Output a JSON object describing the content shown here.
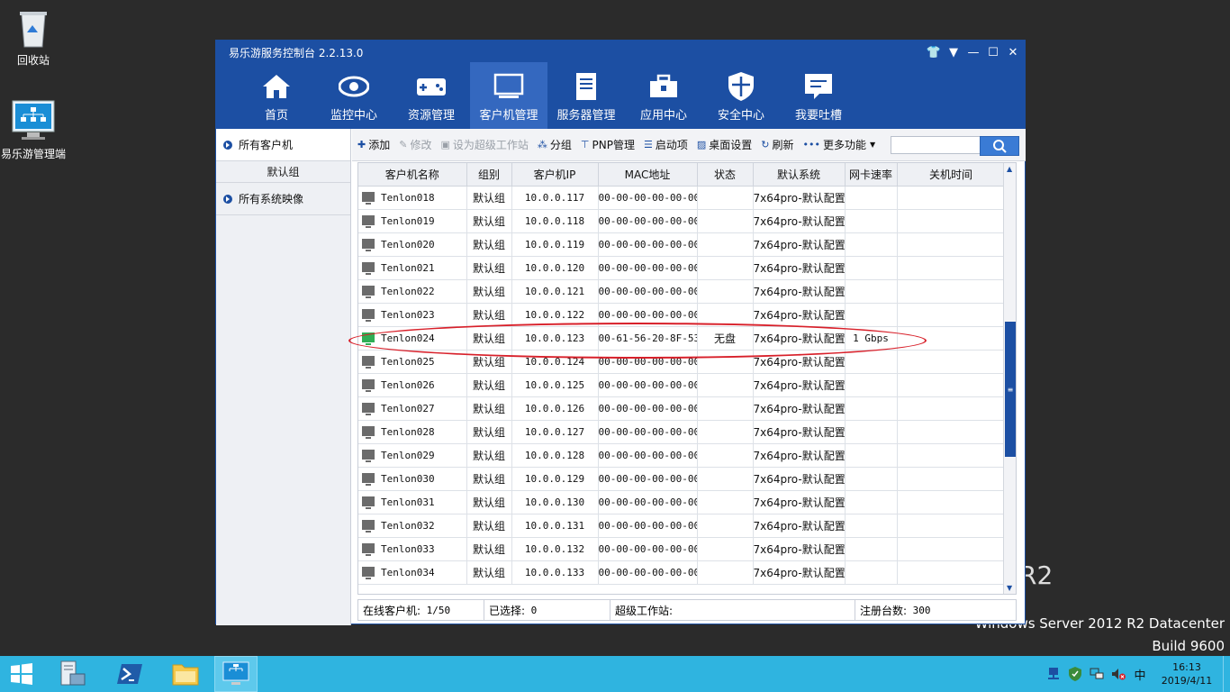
{
  "desktop": {
    "recycle_label": "回收站",
    "manager_label": "易乐游管理端",
    "watermark_line1": "Windows Server 2012 R2 Datacenter",
    "watermark_line2": "Build 9600",
    "watermark_r2": "R2"
  },
  "app": {
    "title": "易乐游服务控制台 2.2.13.0",
    "nav": [
      {
        "label": "首页"
      },
      {
        "label": "监控中心"
      },
      {
        "label": "资源管理"
      },
      {
        "label": "客户机管理"
      },
      {
        "label": "服务器管理"
      },
      {
        "label": "应用中心"
      },
      {
        "label": "安全中心"
      },
      {
        "label": "我要吐槽"
      }
    ],
    "active_nav": "客户机管理"
  },
  "sidebar": {
    "all_clients": "所有客户机",
    "default_group": "默认组",
    "all_images": "所有系统映像"
  },
  "toolbar": {
    "add": "添加",
    "edit": "修改",
    "set_super": "设为超级工作站",
    "group": "分组",
    "pnp": "PNP管理",
    "boot": "启动项",
    "desktop": "桌面设置",
    "refresh": "刷新",
    "more": "更多功能",
    "search_placeholder": ""
  },
  "table": {
    "headers": [
      "客户机名称",
      "组别",
      "客户机IP",
      "MAC地址",
      "状态",
      "默认系统",
      "网卡速率",
      "关机时间"
    ],
    "rows": [
      {
        "name": "Tenlon018",
        "group": "默认组",
        "ip": "10.0.0.117",
        "mac": "00-00-00-00-00-00",
        "status": "",
        "system": "7x64pro-默认配置",
        "speed": "",
        "shutdown": "",
        "online": false
      },
      {
        "name": "Tenlon019",
        "group": "默认组",
        "ip": "10.0.0.118",
        "mac": "00-00-00-00-00-00",
        "status": "",
        "system": "7x64pro-默认配置",
        "speed": "",
        "shutdown": "",
        "online": false
      },
      {
        "name": "Tenlon020",
        "group": "默认组",
        "ip": "10.0.0.119",
        "mac": "00-00-00-00-00-00",
        "status": "",
        "system": "7x64pro-默认配置",
        "speed": "",
        "shutdown": "",
        "online": false
      },
      {
        "name": "Tenlon021",
        "group": "默认组",
        "ip": "10.0.0.120",
        "mac": "00-00-00-00-00-00",
        "status": "",
        "system": "7x64pro-默认配置",
        "speed": "",
        "shutdown": "",
        "online": false
      },
      {
        "name": "Tenlon022",
        "group": "默认组",
        "ip": "10.0.0.121",
        "mac": "00-00-00-00-00-00",
        "status": "",
        "system": "7x64pro-默认配置",
        "speed": "",
        "shutdown": "",
        "online": false
      },
      {
        "name": "Tenlon023",
        "group": "默认组",
        "ip": "10.0.0.122",
        "mac": "00-00-00-00-00-00",
        "status": "",
        "system": "7x64pro-默认配置",
        "speed": "",
        "shutdown": "",
        "online": false
      },
      {
        "name": "Tenlon024",
        "group": "默认组",
        "ip": "10.0.0.123",
        "mac": "00-61-56-20-8F-53",
        "status": "无盘",
        "system": "7x64pro-默认配置",
        "speed": "1 Gbps",
        "shutdown": "",
        "online": true
      },
      {
        "name": "Tenlon025",
        "group": "默认组",
        "ip": "10.0.0.124",
        "mac": "00-00-00-00-00-00",
        "status": "",
        "system": "7x64pro-默认配置",
        "speed": "",
        "shutdown": "",
        "online": false
      },
      {
        "name": "Tenlon026",
        "group": "默认组",
        "ip": "10.0.0.125",
        "mac": "00-00-00-00-00-00",
        "status": "",
        "system": "7x64pro-默认配置",
        "speed": "",
        "shutdown": "",
        "online": false
      },
      {
        "name": "Tenlon027",
        "group": "默认组",
        "ip": "10.0.0.126",
        "mac": "00-00-00-00-00-00",
        "status": "",
        "system": "7x64pro-默认配置",
        "speed": "",
        "shutdown": "",
        "online": false
      },
      {
        "name": "Tenlon028",
        "group": "默认组",
        "ip": "10.0.0.127",
        "mac": "00-00-00-00-00-00",
        "status": "",
        "system": "7x64pro-默认配置",
        "speed": "",
        "shutdown": "",
        "online": false
      },
      {
        "name": "Tenlon029",
        "group": "默认组",
        "ip": "10.0.0.128",
        "mac": "00-00-00-00-00-00",
        "status": "",
        "system": "7x64pro-默认配置",
        "speed": "",
        "shutdown": "",
        "online": false
      },
      {
        "name": "Tenlon030",
        "group": "默认组",
        "ip": "10.0.0.129",
        "mac": "00-00-00-00-00-00",
        "status": "",
        "system": "7x64pro-默认配置",
        "speed": "",
        "shutdown": "",
        "online": false
      },
      {
        "name": "Tenlon031",
        "group": "默认组",
        "ip": "10.0.0.130",
        "mac": "00-00-00-00-00-00",
        "status": "",
        "system": "7x64pro-默认配置",
        "speed": "",
        "shutdown": "",
        "online": false
      },
      {
        "name": "Tenlon032",
        "group": "默认组",
        "ip": "10.0.0.131",
        "mac": "00-00-00-00-00-00",
        "status": "",
        "system": "7x64pro-默认配置",
        "speed": "",
        "shutdown": "",
        "online": false
      },
      {
        "name": "Tenlon033",
        "group": "默认组",
        "ip": "10.0.0.132",
        "mac": "00-00-00-00-00-00",
        "status": "",
        "system": "7x64pro-默认配置",
        "speed": "",
        "shutdown": "",
        "online": false
      },
      {
        "name": "Tenlon034",
        "group": "默认组",
        "ip": "10.0.0.133",
        "mac": "00-00-00-00-00-00",
        "status": "",
        "system": "7x64pro-默认配置",
        "speed": "",
        "shutdown": "",
        "online": false
      }
    ]
  },
  "statusbar": {
    "online_label": "在线客户机:",
    "online_value": "1/50",
    "selected_label": "已选择:",
    "selected_value": "0",
    "super_label": "超级工作站:",
    "super_value": "",
    "registered_label": "注册台数:",
    "registered_value": "300"
  },
  "taskbar": {
    "ime": "中",
    "time": "16:13",
    "date": "2019/4/11"
  },
  "colors": {
    "titlebar": "#1c4fa3",
    "nav_active": "#3468bf",
    "highlight_ellipse": "#d8202a",
    "online_icon": "#2fae55",
    "taskbar": "#2fb4e0"
  }
}
